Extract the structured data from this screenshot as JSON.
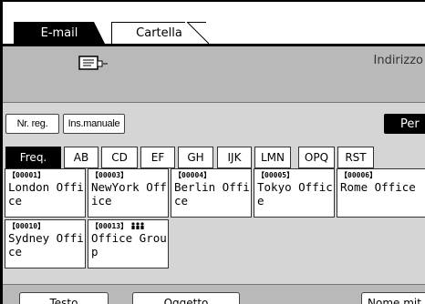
{
  "tabs": {
    "email": "E-mail",
    "folder": "Cartella"
  },
  "header": {
    "address_label": "Indirizzo",
    "icon": "monitor-icon"
  },
  "toolbar": {
    "reg_no": "Nr. reg.",
    "manual": "Ins.manuale",
    "per": "Per"
  },
  "index_tabs": [
    "Freq.",
    "AB",
    "CD",
    "EF",
    "GH",
    "IJK",
    "LMN",
    "OPQ",
    "RST"
  ],
  "destinations": [
    {
      "code": "【00001】",
      "name": "London Office"
    },
    {
      "code": "【00003】",
      "name": "NewYork Office"
    },
    {
      "code": "【00004】",
      "name": "Berlin Office"
    },
    {
      "code": "【00005】",
      "name": "Tokyo Office"
    },
    {
      "code": "【00006】",
      "name": "Rome Office"
    },
    {
      "code": "【00010】",
      "name": "Sydney Office"
    },
    {
      "code": "【00013】",
      "name": "Office Group",
      "group_icon": "group-icon"
    }
  ],
  "bottom": {
    "text": "Testo",
    "subject": "Oggetto",
    "sender": "Nome mit"
  }
}
